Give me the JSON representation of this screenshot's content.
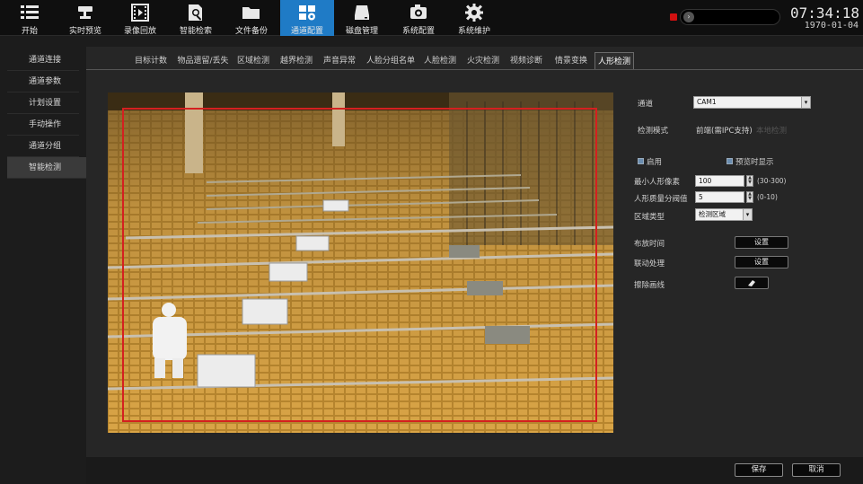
{
  "topbar": {
    "items": [
      {
        "label": "开始",
        "icon": "menu-grid-icon"
      },
      {
        "label": "实时预览",
        "icon": "camera-icon"
      },
      {
        "label": "录像回放",
        "icon": "film-icon"
      },
      {
        "label": "智能检索",
        "icon": "magnify-doc-icon"
      },
      {
        "label": "文件备份",
        "icon": "folder-icon"
      },
      {
        "label": "通道配置",
        "icon": "channel-config-icon"
      },
      {
        "label": "磁盘管理",
        "icon": "disk-icon"
      },
      {
        "label": "系统配置",
        "icon": "camera-gear-icon"
      },
      {
        "label": "系统维护",
        "icon": "gear-icon"
      }
    ],
    "active_index": 5,
    "clock_time": "07:34:18",
    "clock_date": "1970-01-04"
  },
  "sidebar": {
    "items": [
      "通道连接",
      "通道参数",
      "计划设置",
      "手动操作",
      "通道分组",
      "智能检测"
    ],
    "active_index": 5
  },
  "tabs": {
    "items": [
      "目标计数",
      "物品遗留/丢失",
      "区域检测",
      "越界检测",
      "声音异常",
      "人脸分组名单",
      "人脸检测",
      "火灾检测",
      "视频诊断",
      "情景变换",
      "人形检测"
    ],
    "active_index": 10
  },
  "form": {
    "channel_label": "通道",
    "channel_value": "CAM1",
    "detect_mode_label": "检测模式",
    "detect_mode_option1": "前端(需IPC支持)",
    "detect_mode_option2": "本地检测",
    "enable_label": "启用",
    "preview_label": "预览时显示",
    "min_pixel_label": "最小人形像素",
    "min_pixel_value": "100",
    "min_pixel_range": "(30-300)",
    "quality_label": "人形质量分阀值",
    "quality_value": "5",
    "quality_range": "(0-10)",
    "area_type_label": "区域类型",
    "area_type_value": "检测区域",
    "schedule_label": "布放时间",
    "schedule_button": "设置",
    "linkage_label": "联动处理",
    "linkage_button": "设置",
    "erase_label": "擦除画线"
  },
  "footer": {
    "save": "保存",
    "cancel": "取消"
  },
  "colors": {
    "accent": "#1f7bc6",
    "detect_region": "#d42020",
    "background": "#1c1c1c"
  }
}
